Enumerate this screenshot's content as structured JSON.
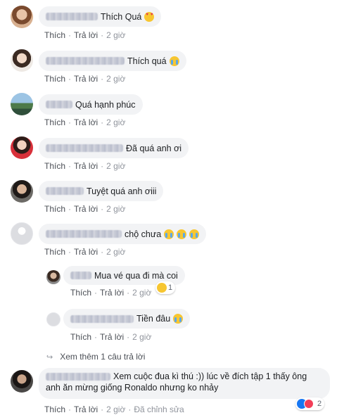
{
  "actions": {
    "like": "Thích",
    "reply": "Trả lời",
    "separator": "·"
  },
  "comments": [
    {
      "text": "Thích Quá",
      "emoji": "heart-eyes-emoji",
      "time": "2 giờ"
    },
    {
      "text": "Thích quá",
      "emoji": "crying-emoji",
      "time": "2 giờ"
    },
    {
      "text": "Quá hạnh phúc",
      "time": "2 giờ"
    },
    {
      "text": "Đã quá anh ơi",
      "time": "2 giờ"
    },
    {
      "text": "Tuyệt quá anh ơiii",
      "time": "2 giờ"
    },
    {
      "text": "chộ chưa",
      "emoji": "crying-emoji",
      "time": "2 giờ"
    }
  ],
  "replies": [
    {
      "text": "Mua vé qua đi mà coi",
      "time": "2 giờ",
      "reaction_count": "1",
      "reaction_icon": "sad-reaction-icon"
    },
    {
      "text": "Tiền đâu",
      "emoji": "crying-emoji",
      "time": "2 giờ"
    }
  ],
  "view_more": "Xem thêm 1 câu trả lời",
  "last_comment": {
    "text_line1": "Xem cuộc đua kì thú :)) lúc về đích tập 1 thấy ông",
    "text_line2": "anh ăn mừng giống Ronaldo nhưng ko nhảy",
    "time": "2 giờ",
    "edited": "Đã chỉnh sửa",
    "reaction_count": "2",
    "reaction_icons": [
      "like-reaction-icon",
      "love-reaction-icon"
    ]
  },
  "colors": {
    "bubble": "#f2f3f5",
    "action_text": "#4b4f56",
    "time_text": "#90949c",
    "like_blue": "#1877f2",
    "love_red": "#f33e58"
  }
}
